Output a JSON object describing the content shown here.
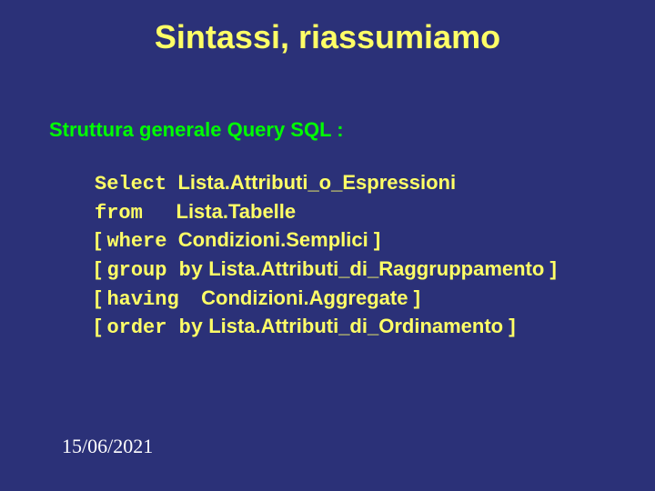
{
  "title": "Sintassi, riassumiamo",
  "subtitle": "Struttura generale Query SQL :",
  "kw": {
    "select": "Select",
    "from": "from",
    "where": "where",
    "groupby": "group by",
    "having": "having",
    "orderby": "order by"
  },
  "brL": "[ ",
  "brR": " ]",
  "arg": {
    "select": "Lista.Attributi_o_Espressioni",
    "from": "Lista.Tabelle",
    "where": "Condizioni.Semplici",
    "groupby": "Lista.Attributi_di_Raggruppamento",
    "having": "Condizioni.Aggregate",
    "orderby": "Lista.Attributi_di_Ordinamento"
  },
  "date": "15/06/2021"
}
